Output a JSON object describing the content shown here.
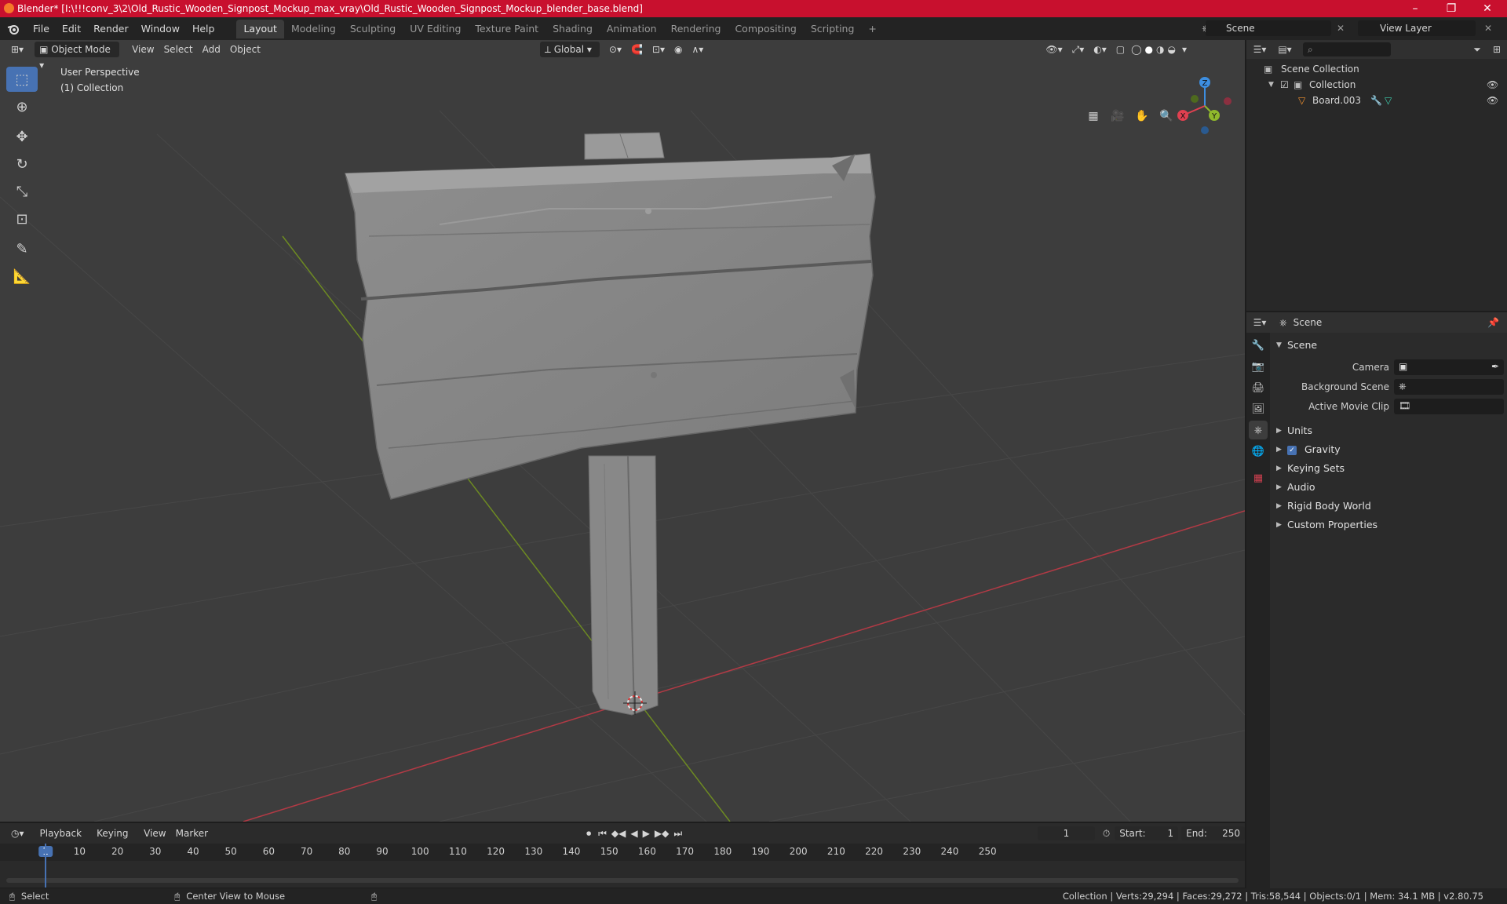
{
  "window": {
    "title": "Blender* [I:\\!!!conv_3\\2\\Old_Rustic_Wooden_Signpost_Mockup_max_vray\\Old_Rustic_Wooden_Signpost_Mockup_blender_base.blend]",
    "minimize": "–",
    "maximize": "❐",
    "close": "✕"
  },
  "menu": [
    "File",
    "Edit",
    "Render",
    "Window",
    "Help"
  ],
  "workspaces": [
    "Layout",
    "Modeling",
    "Sculpting",
    "UV Editing",
    "Texture Paint",
    "Shading",
    "Animation",
    "Rendering",
    "Compositing",
    "Scripting"
  ],
  "active_workspace": "Layout",
  "add_workspace": "+",
  "scene_name": "Scene",
  "view_layer_name": "View Layer",
  "viewport": {
    "mode": "Object Mode",
    "menus": [
      "View",
      "Select",
      "Add",
      "Object"
    ],
    "orientation": "Global",
    "perspective_label": "User Perspective",
    "collection_label": "(1) Collection",
    "gizmo_axes": {
      "x": "X",
      "y": "Y",
      "z": "Z"
    }
  },
  "outliner": {
    "root": "Scene Collection",
    "collection": "Collection",
    "object": "Board.003"
  },
  "properties": {
    "header": "Scene",
    "panel": "Scene",
    "rows": [
      {
        "label": "Camera"
      },
      {
        "label": "Background Scene"
      },
      {
        "label": "Active Movie Clip"
      }
    ],
    "subpanels": [
      "Units",
      "Gravity",
      "Keying Sets",
      "Audio",
      "Rigid Body World",
      "Custom Properties"
    ],
    "gravity_checked": true
  },
  "timeline": {
    "menus": [
      "Playback",
      "Keying",
      "View",
      "Marker"
    ],
    "current_frame": "1",
    "start_label": "Start:",
    "start": "1",
    "end_label": "End:",
    "end": "250",
    "ticks": [
      "1",
      "10",
      "20",
      "30",
      "40",
      "50",
      "60",
      "70",
      "80",
      "90",
      "100",
      "110",
      "120",
      "130",
      "140",
      "150",
      "160",
      "170",
      "180",
      "190",
      "200",
      "210",
      "220",
      "230",
      "240",
      "250"
    ]
  },
  "statusbar": {
    "left": "Select",
    "middle": "Center View to Mouse",
    "right": "Collection | Verts:29,294 | Faces:29,272 | Tris:58,544 | Objects:0/1 | Mem: 34.1 MB | v2.80.75"
  },
  "colors": {
    "titlebar": "#c8102e",
    "accent": "#4772b3",
    "x_axis": "#e04050",
    "y_axis": "#8fb82c",
    "z_axis": "#3d8ee0"
  }
}
